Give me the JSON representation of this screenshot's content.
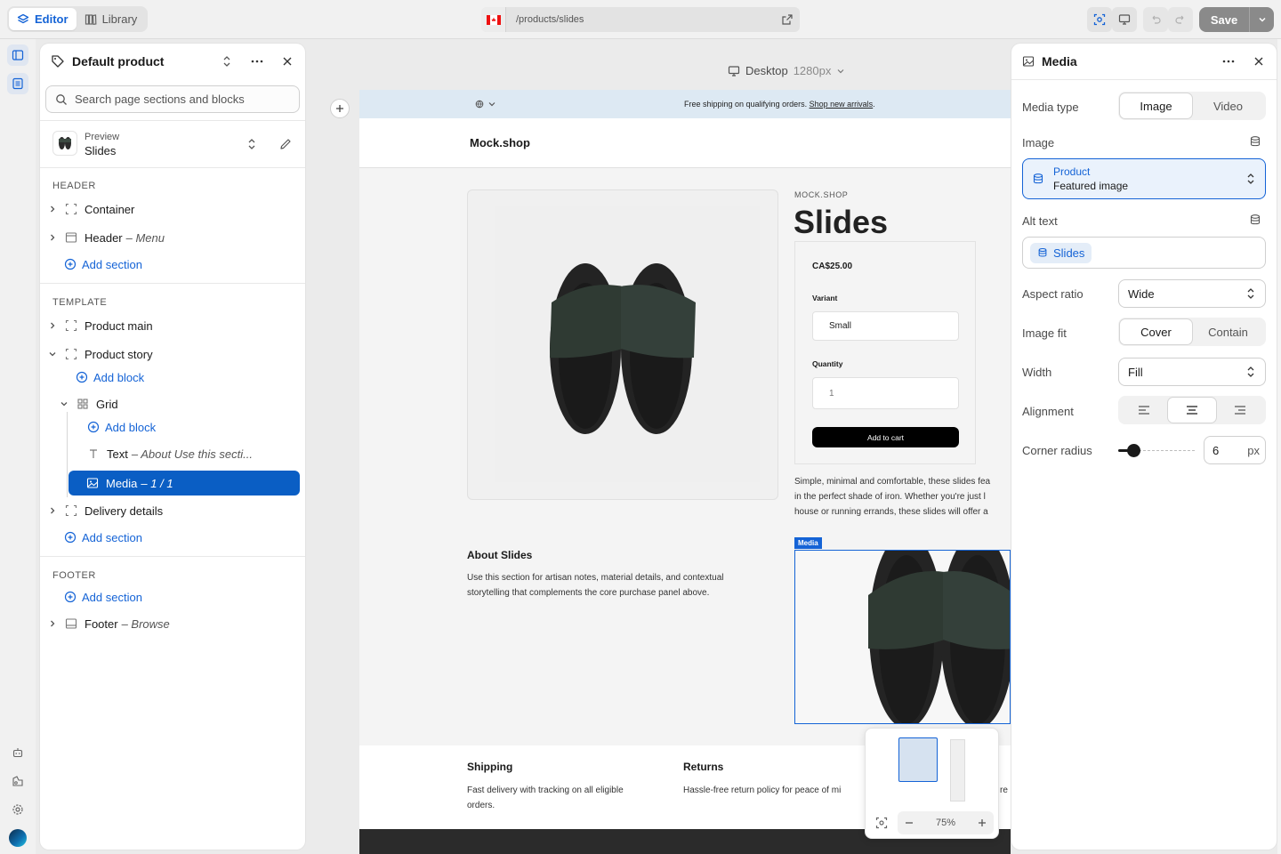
{
  "topbar": {
    "editor_tab": "Editor",
    "library_tab": "Library",
    "url": "/products/slides",
    "save_label": "Save"
  },
  "left_panel": {
    "title": "Default product",
    "search_placeholder": "Search page sections and blocks",
    "preview_label": "Preview",
    "preview_value": "Slides",
    "header_group": "HEADER",
    "template_group": "TEMPLATE",
    "footer_group": "FOOTER",
    "items": {
      "container": "Container",
      "header": "Header",
      "header_sub": "– Menu",
      "add_section": "Add section",
      "product_main": "Product main",
      "product_story": "Product story",
      "add_block": "Add block",
      "grid": "Grid",
      "text": "Text",
      "text_sub": "– About Use this secti...",
      "media": "Media",
      "media_sub": "– 1 / 1",
      "delivery": "Delivery details",
      "footer": "Footer",
      "footer_sub": "– Browse"
    }
  },
  "canvas": {
    "device": "Desktop",
    "device_size": "1280px",
    "announcement": "Free shipping on qualifying orders.",
    "announcement_link": "Shop new arrivals",
    "announcement_end": ".",
    "shop_name": "Mock.shop",
    "vendor": "MOCK.SHOP",
    "product_title": "Slides",
    "price": "CA$25.00",
    "variant_label": "Variant",
    "variant_value": "Small",
    "quantity_label": "Quantity",
    "quantity_value": "1",
    "add_to_cart": "Add to cart",
    "description_l1": "Simple, minimal and comfortable, these slides fea",
    "description_l2": "in the perfect shade of iron. Whether you're just l",
    "description_l3": "house or running errands, these slides will offer a",
    "about_title": "About Slides",
    "about_l1": "Use this section for artisan notes, material details, and contextual",
    "about_l2": "storytelling that complements the core purchase panel above.",
    "media_tag": "Media",
    "shipping_title": "Shipping",
    "shipping_l1": "Fast delivery with tracking on all eligible",
    "shipping_l2": "orders.",
    "returns_title": "Returns",
    "returns_l1": "Hassle-free return policy for peace of mi",
    "returns_cut": "re",
    "zoom": "75%"
  },
  "right_panel": {
    "title": "Media",
    "media_type_label": "Media type",
    "media_type_options": [
      "Image",
      "Video"
    ],
    "media_type_selected": "Image",
    "image_label": "Image",
    "image_source_title": "Product",
    "image_source_value": "Featured image",
    "alt_label": "Alt text",
    "alt_value": "Slides",
    "aspect_label": "Aspect ratio",
    "aspect_value": "Wide",
    "fit_label": "Image fit",
    "fit_options": [
      "Cover",
      "Contain"
    ],
    "fit_selected": "Cover",
    "width_label": "Width",
    "width_value": "Fill",
    "alignment_label": "Alignment",
    "alignment_selected": "center",
    "radius_label": "Corner radius",
    "radius_value": "6",
    "radius_unit": "px"
  },
  "colors": {
    "accent": "#1463d6",
    "selected_row": "#0a5ec4",
    "save_bg": "#8a8a8a"
  }
}
